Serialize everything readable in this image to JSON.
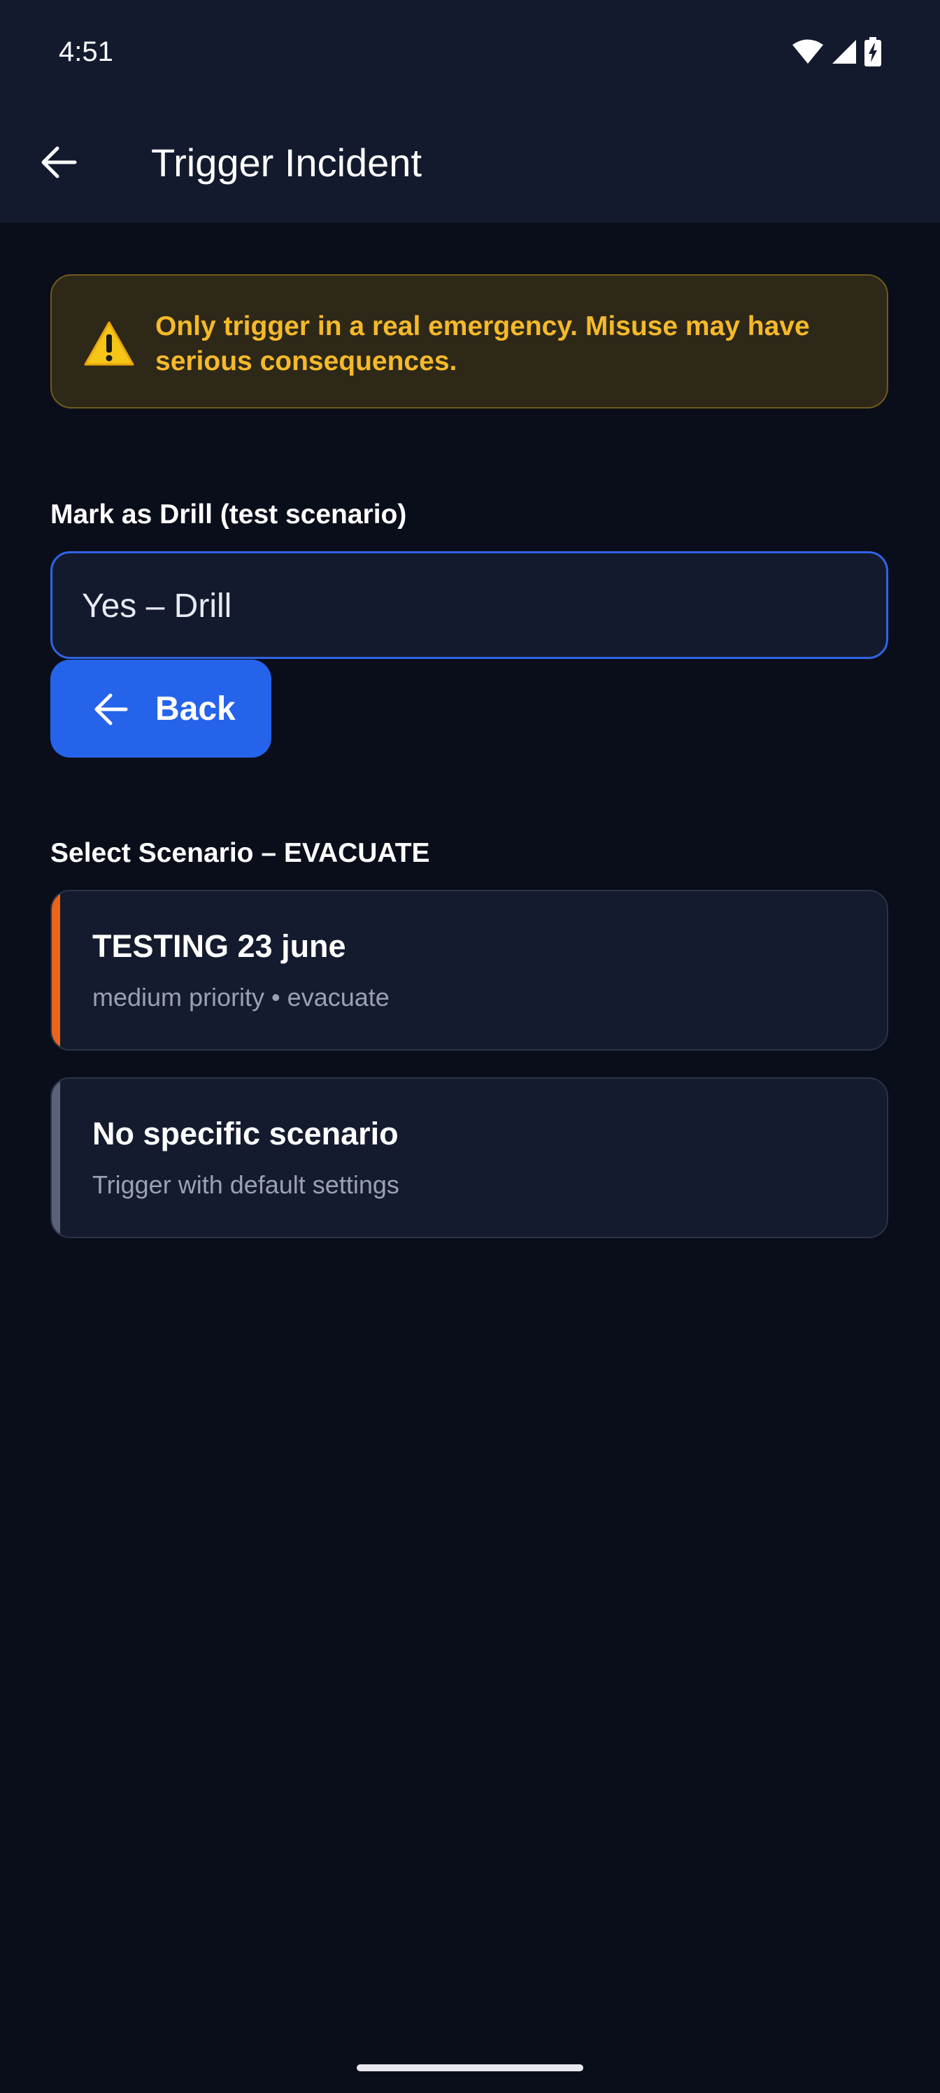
{
  "status_bar": {
    "time": "4:51",
    "icons": [
      "wifi-icon",
      "cellular-signal-icon",
      "battery-charging-icon"
    ]
  },
  "app_bar": {
    "title": "Trigger Incident",
    "back_icon": "arrow-left-icon"
  },
  "warning": {
    "icon": "warning-triangle-icon",
    "text": "Only trigger in a real emergency. Misuse may have serious consequences.",
    "color": "#f5b92a"
  },
  "drill": {
    "label": "Mark as Drill (test scenario)",
    "selected_value": "Yes – Drill",
    "back_button_label": "Back",
    "back_button_icon": "arrow-left-icon",
    "back_button_color": "#2563eb"
  },
  "scenarios": {
    "label": "Select Scenario – EVACUATE",
    "items": [
      {
        "title": "TESTING 23 june",
        "subtitle": "medium priority • evacuate",
        "accent_color": "#e8651a"
      },
      {
        "title": "No specific scenario",
        "subtitle": "Trigger with default settings",
        "accent_color": "#5a6278"
      }
    ]
  }
}
